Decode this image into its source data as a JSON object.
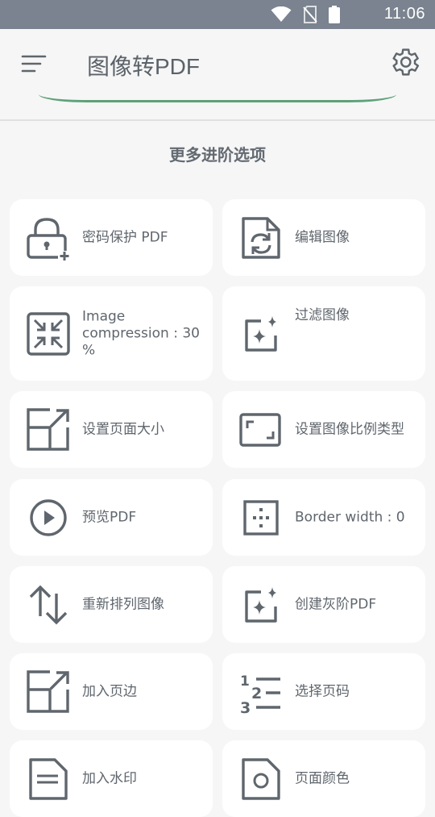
{
  "status_bar": {
    "time": "11:06",
    "icons": [
      "wifi-icon",
      "no-sim-icon",
      "battery-icon"
    ]
  },
  "app_bar": {
    "title": "图像转PDF",
    "menu_icon": "menu-icon",
    "settings_icon": "gear-icon"
  },
  "section_title": "更多进阶选项",
  "options": [
    {
      "label": "密码保护 PDF",
      "icon": "lock-add-icon"
    },
    {
      "label": "编辑图像",
      "icon": "edit-image-icon"
    },
    {
      "label": "Image compression : 30 %",
      "icon": "compress-icon"
    },
    {
      "label": "过滤图像",
      "icon": "filter-sparkle-icon"
    },
    {
      "label": "设置页面大小",
      "icon": "page-size-icon"
    },
    {
      "label": "设置图像比例类型",
      "icon": "aspect-ratio-icon"
    },
    {
      "label": "预览PDF",
      "icon": "play-circle-icon"
    },
    {
      "label": "Border width : 0",
      "icon": "border-icon"
    },
    {
      "label": "重新排列图像",
      "icon": "swap-vertical-icon"
    },
    {
      "label": "创建灰阶PDF",
      "icon": "grayscale-sparkle-icon"
    },
    {
      "label": "加入页边",
      "icon": "margin-icon"
    },
    {
      "label": "选择页码",
      "icon": "page-number-icon"
    },
    {
      "label": "加入水印",
      "icon": "watermark-icon"
    },
    {
      "label": "页面颜色",
      "icon": "page-color-icon"
    }
  ],
  "colors": {
    "status_bar": "#7a838f",
    "background": "#f6f6f6",
    "card": "#ffffff",
    "icon": "#5f666d",
    "accent": "#5ea17a"
  }
}
